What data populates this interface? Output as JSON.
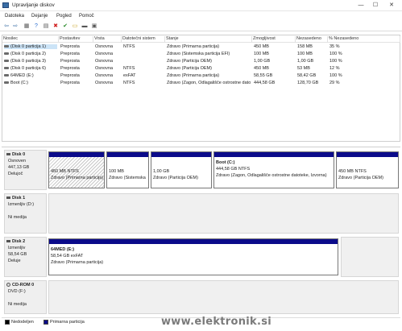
{
  "window": {
    "title": "Upravljanje diskov",
    "min": "—",
    "max": "☐",
    "close": "✕"
  },
  "menu": [
    "Datoteka",
    "Dejanje",
    "Pogled",
    "Pomoč"
  ],
  "toolbar_icons": [
    "back-arrow-icon",
    "forward-arrow-icon",
    "grid-view-icon",
    "help-icon",
    "properties-icon",
    "delete-x-icon",
    "check-icon",
    "open-folder-icon",
    "disk-icon",
    "info-icon"
  ],
  "columns": [
    "Nosilec",
    "Postavitev",
    "Vrsta",
    "Datotečni sistem",
    "Stanje",
    "Zmogljivost",
    "Nezasedeno",
    "% Nezasedeno"
  ],
  "volumes": [
    {
      "name": "(Disk 0 particija 1)",
      "layout": "Preprosta",
      "type": "Osnovna",
      "fs": "NTFS",
      "status": "Zdravo (Primarna particija)",
      "capacity": "450 MB",
      "free": "158 MB",
      "pct": "35 %"
    },
    {
      "name": "(Disk 0 particija 2)",
      "layout": "Preprosta",
      "type": "Osnovna",
      "fs": "",
      "status": "Zdravo (Sistemska particija EFI)",
      "capacity": "100 MB",
      "free": "100 MB",
      "pct": "100 %"
    },
    {
      "name": "(Disk 0 particija 3)",
      "layout": "Preprosta",
      "type": "Osnovna",
      "fs": "",
      "status": "Zdravo (Particija OEM)",
      "capacity": "1,00 GB",
      "free": "1,00 GB",
      "pct": "100 %"
    },
    {
      "name": "(Disk 0 particija 6)",
      "layout": "Preprosta",
      "type": "Osnovna",
      "fs": "NTFS",
      "status": "Zdravo (Particija OEM)",
      "capacity": "450 MB",
      "free": "53 MB",
      "pct": "12 %"
    },
    {
      "name": "64MED (E:)",
      "layout": "Preprosta",
      "type": "Osnovna",
      "fs": "exFAT",
      "status": "Zdravo (Primarna particija)",
      "capacity": "58,55 GB",
      "free": "58,42 GB",
      "pct": "100 %"
    },
    {
      "name": "Boot (C:)",
      "layout": "Preprosta",
      "type": "Osnovna",
      "fs": "NTFS",
      "status": "Zdravo (Zagon, Odlagališče ostrostne datoteke, ...)",
      "capacity": "444,58 GB",
      "free": "128,70 GB",
      "pct": "29 %"
    }
  ],
  "disks": [
    {
      "lines": [
        "Disk 0",
        "Osnoven",
        "447,13 GB",
        "Delujoč"
      ],
      "partitions": [
        {
          "size": "450 MB NTFS",
          "status": "Zdravo (Primarna particija)"
        },
        {
          "size": "100 MB",
          "status": "Zdravo (Sistemska"
        },
        {
          "size": "1,00 GB",
          "status": "Zdravo (Particija OEM)"
        },
        {
          "name": "Boot (C:)",
          "size": "444,58 GB NTFS",
          "status": "Zdravo (Zagon, Odlagališče ostrostne datoteke, Izvorna)"
        },
        {
          "size": "450 MB NTFS",
          "status": "Zdravo (Particija OEM)"
        }
      ]
    },
    {
      "lines": [
        "Disk 1",
        "Izmenljiv (D:)",
        "",
        "Ni medija"
      ]
    },
    {
      "lines": [
        "Disk 2",
        "Izmenljiv",
        "58,54 GB",
        "Deluje"
      ],
      "partitions": [
        {
          "name": "64MED (E:)",
          "size": "58,54 GB exFAT",
          "status": "Zdravo (Primarna particija)"
        }
      ]
    },
    {
      "lines": [
        "CD-ROM 0",
        "DVD (F:)",
        "",
        "Ni medija"
      ]
    }
  ],
  "legend": [
    {
      "label": "Nedodeljen",
      "color": "#000000"
    },
    {
      "label": "Primarna particija",
      "color": "#0b0b8a"
    }
  ],
  "watermark": "www.elektronik.si"
}
